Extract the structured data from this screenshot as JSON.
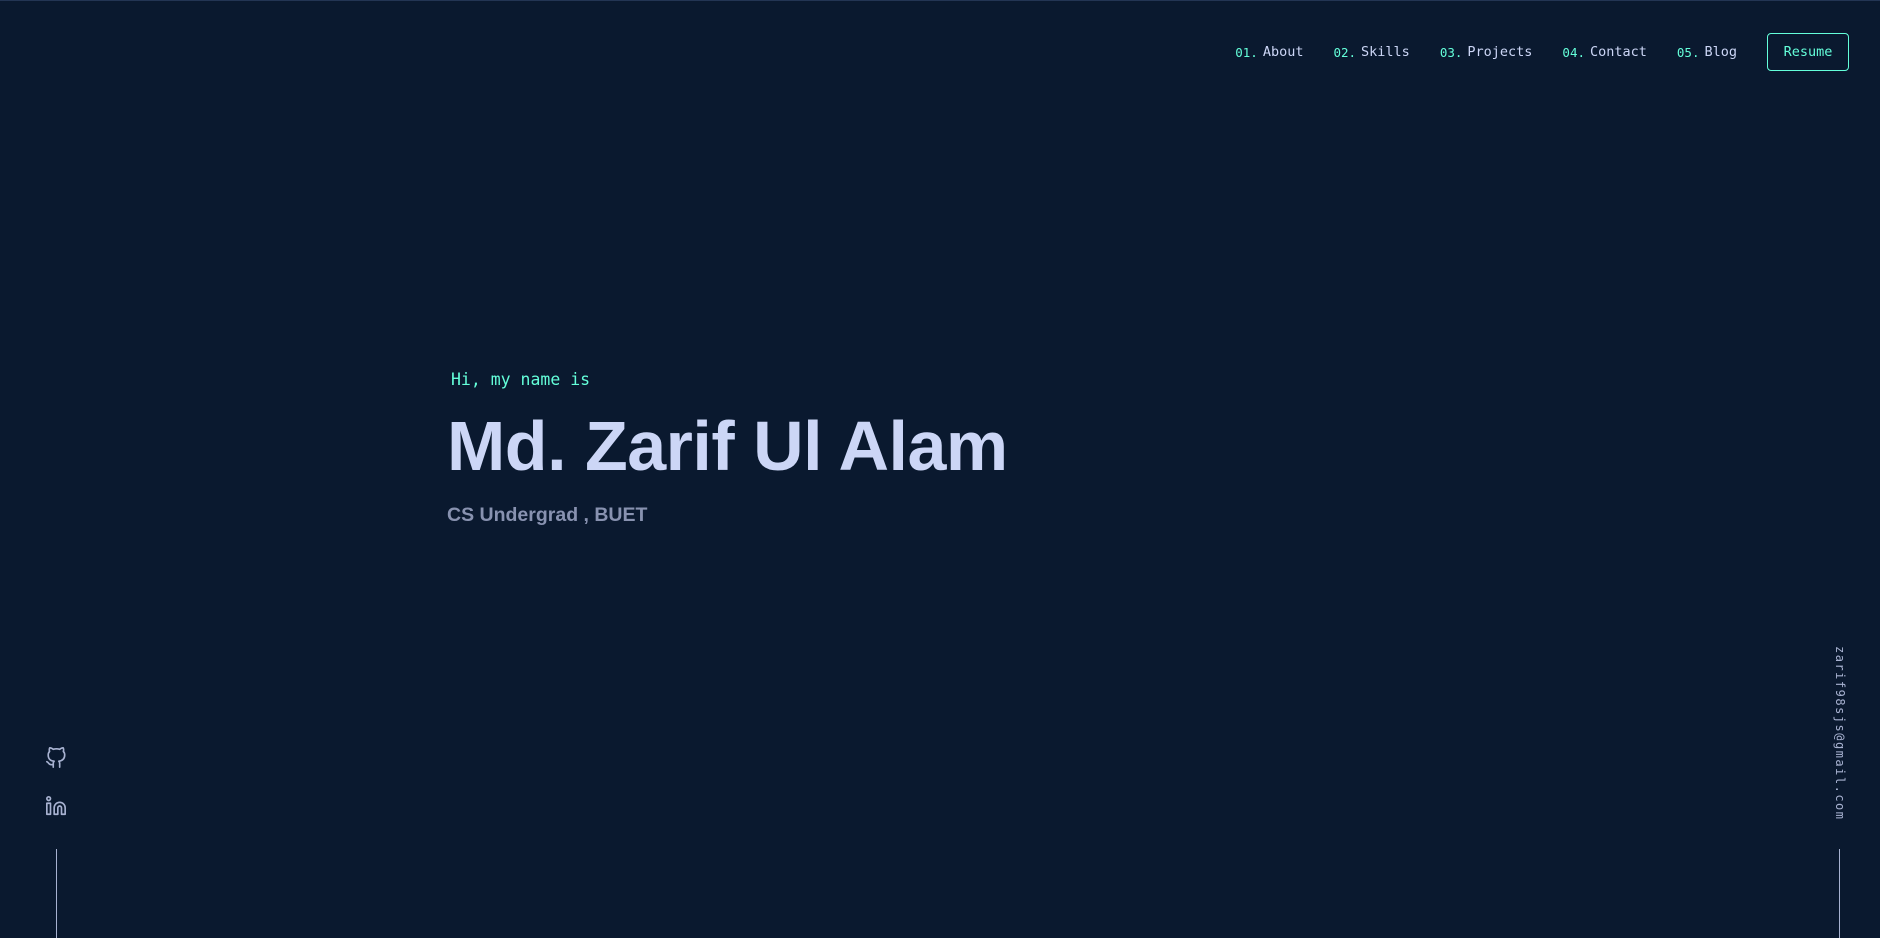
{
  "nav": {
    "items": [
      {
        "num": "01.",
        "label": "About"
      },
      {
        "num": "02.",
        "label": "Skills"
      },
      {
        "num": "03.",
        "label": "Projects"
      },
      {
        "num": "04.",
        "label": "Contact"
      },
      {
        "num": "05.",
        "label": "Blog"
      }
    ],
    "resume_label": "Resume"
  },
  "hero": {
    "greeting": "Hi, my name is",
    "name": "Md. Zarif Ul Alam",
    "subtitle": "CS Undergrad , BUET"
  },
  "social": {
    "icons": [
      "github-icon",
      "linkedin-icon"
    ]
  },
  "contact": {
    "email": "zarif98sjs@gmail.com"
  },
  "colors": {
    "background": "#0a192f",
    "accent": "#64ffda",
    "text_light": "#ccd6f6",
    "text_muted": "#8892b0"
  }
}
